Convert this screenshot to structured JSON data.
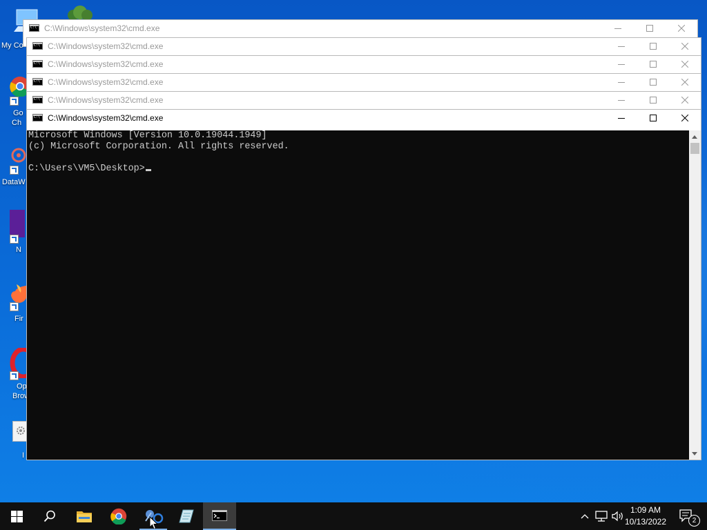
{
  "desktop": {
    "icons": [
      {
        "label": "My Co"
      },
      {
        "label": "Go"
      },
      {
        "label": "Ch"
      },
      {
        "label": "DataW"
      },
      {
        "label": "N"
      },
      {
        "label": "Fir"
      },
      {
        "label": "Op"
      },
      {
        "label": "Brow"
      },
      {
        "label": "I"
      }
    ]
  },
  "windows": [
    {
      "title": "C:\\Windows\\system32\\cmd.exe"
    },
    {
      "title": "C:\\Windows\\system32\\cmd.exe"
    },
    {
      "title": "C:\\Windows\\system32\\cmd.exe"
    },
    {
      "title": "C:\\Windows\\system32\\cmd.exe"
    },
    {
      "title": "C:\\Windows\\system32\\cmd.exe"
    },
    {
      "title": "C:\\Windows\\system32\\cmd.exe"
    }
  ],
  "console": {
    "lines": [
      "Microsoft Windows [Version 10.0.19044.1949]",
      "(c) Microsoft Corporation. All rights reserved.",
      "",
      "C:\\Users\\VM5\\Desktop>"
    ]
  },
  "taskbar": {
    "pinned": [
      {
        "icon": "windows-start-icon"
      },
      {
        "icon": "search-icon"
      },
      {
        "icon": "file-explorer-icon"
      },
      {
        "icon": "chrome-icon"
      },
      {
        "icon": "network-app-icon"
      },
      {
        "icon": "notepad-icon"
      },
      {
        "icon": "cmd-icon"
      }
    ],
    "clock": {
      "time": "1:09 AM",
      "date": "10/13/2022"
    },
    "notifications": {
      "count": "2"
    }
  },
  "colors": {
    "console_bg": "#0c0c0c",
    "console_fg": "#cccccc",
    "taskbar_bg": "#101010",
    "accent": "#7db0e8"
  }
}
